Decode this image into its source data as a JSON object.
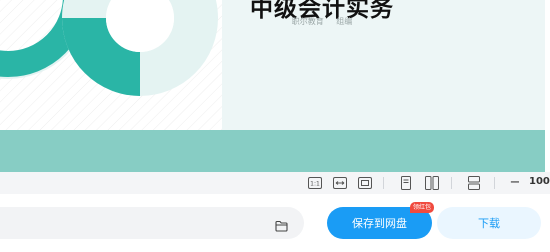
{
  "document": {
    "cover_title": "中级会计实务",
    "cover_meta": [
      "职尔教育",
      "组编"
    ],
    "colors": {
      "teal": "#2ab5a6",
      "pale_teal": "#e4f3f2",
      "band": "#87cdc4",
      "panel": "#edf6f6"
    }
  },
  "toolbar": {
    "icons": [
      "actual-size-icon",
      "fit-width-icon",
      "fit-page-icon",
      "single-page-icon",
      "two-page-icon",
      "continuous-scroll-icon",
      "zoom-out-icon"
    ],
    "zoom_minus": "−",
    "zoom_value": "100"
  },
  "action_bar": {
    "save_label": "保存到网盘",
    "badge_label": "领红包",
    "download_label": "下载",
    "accent": "#1a9cf5"
  }
}
